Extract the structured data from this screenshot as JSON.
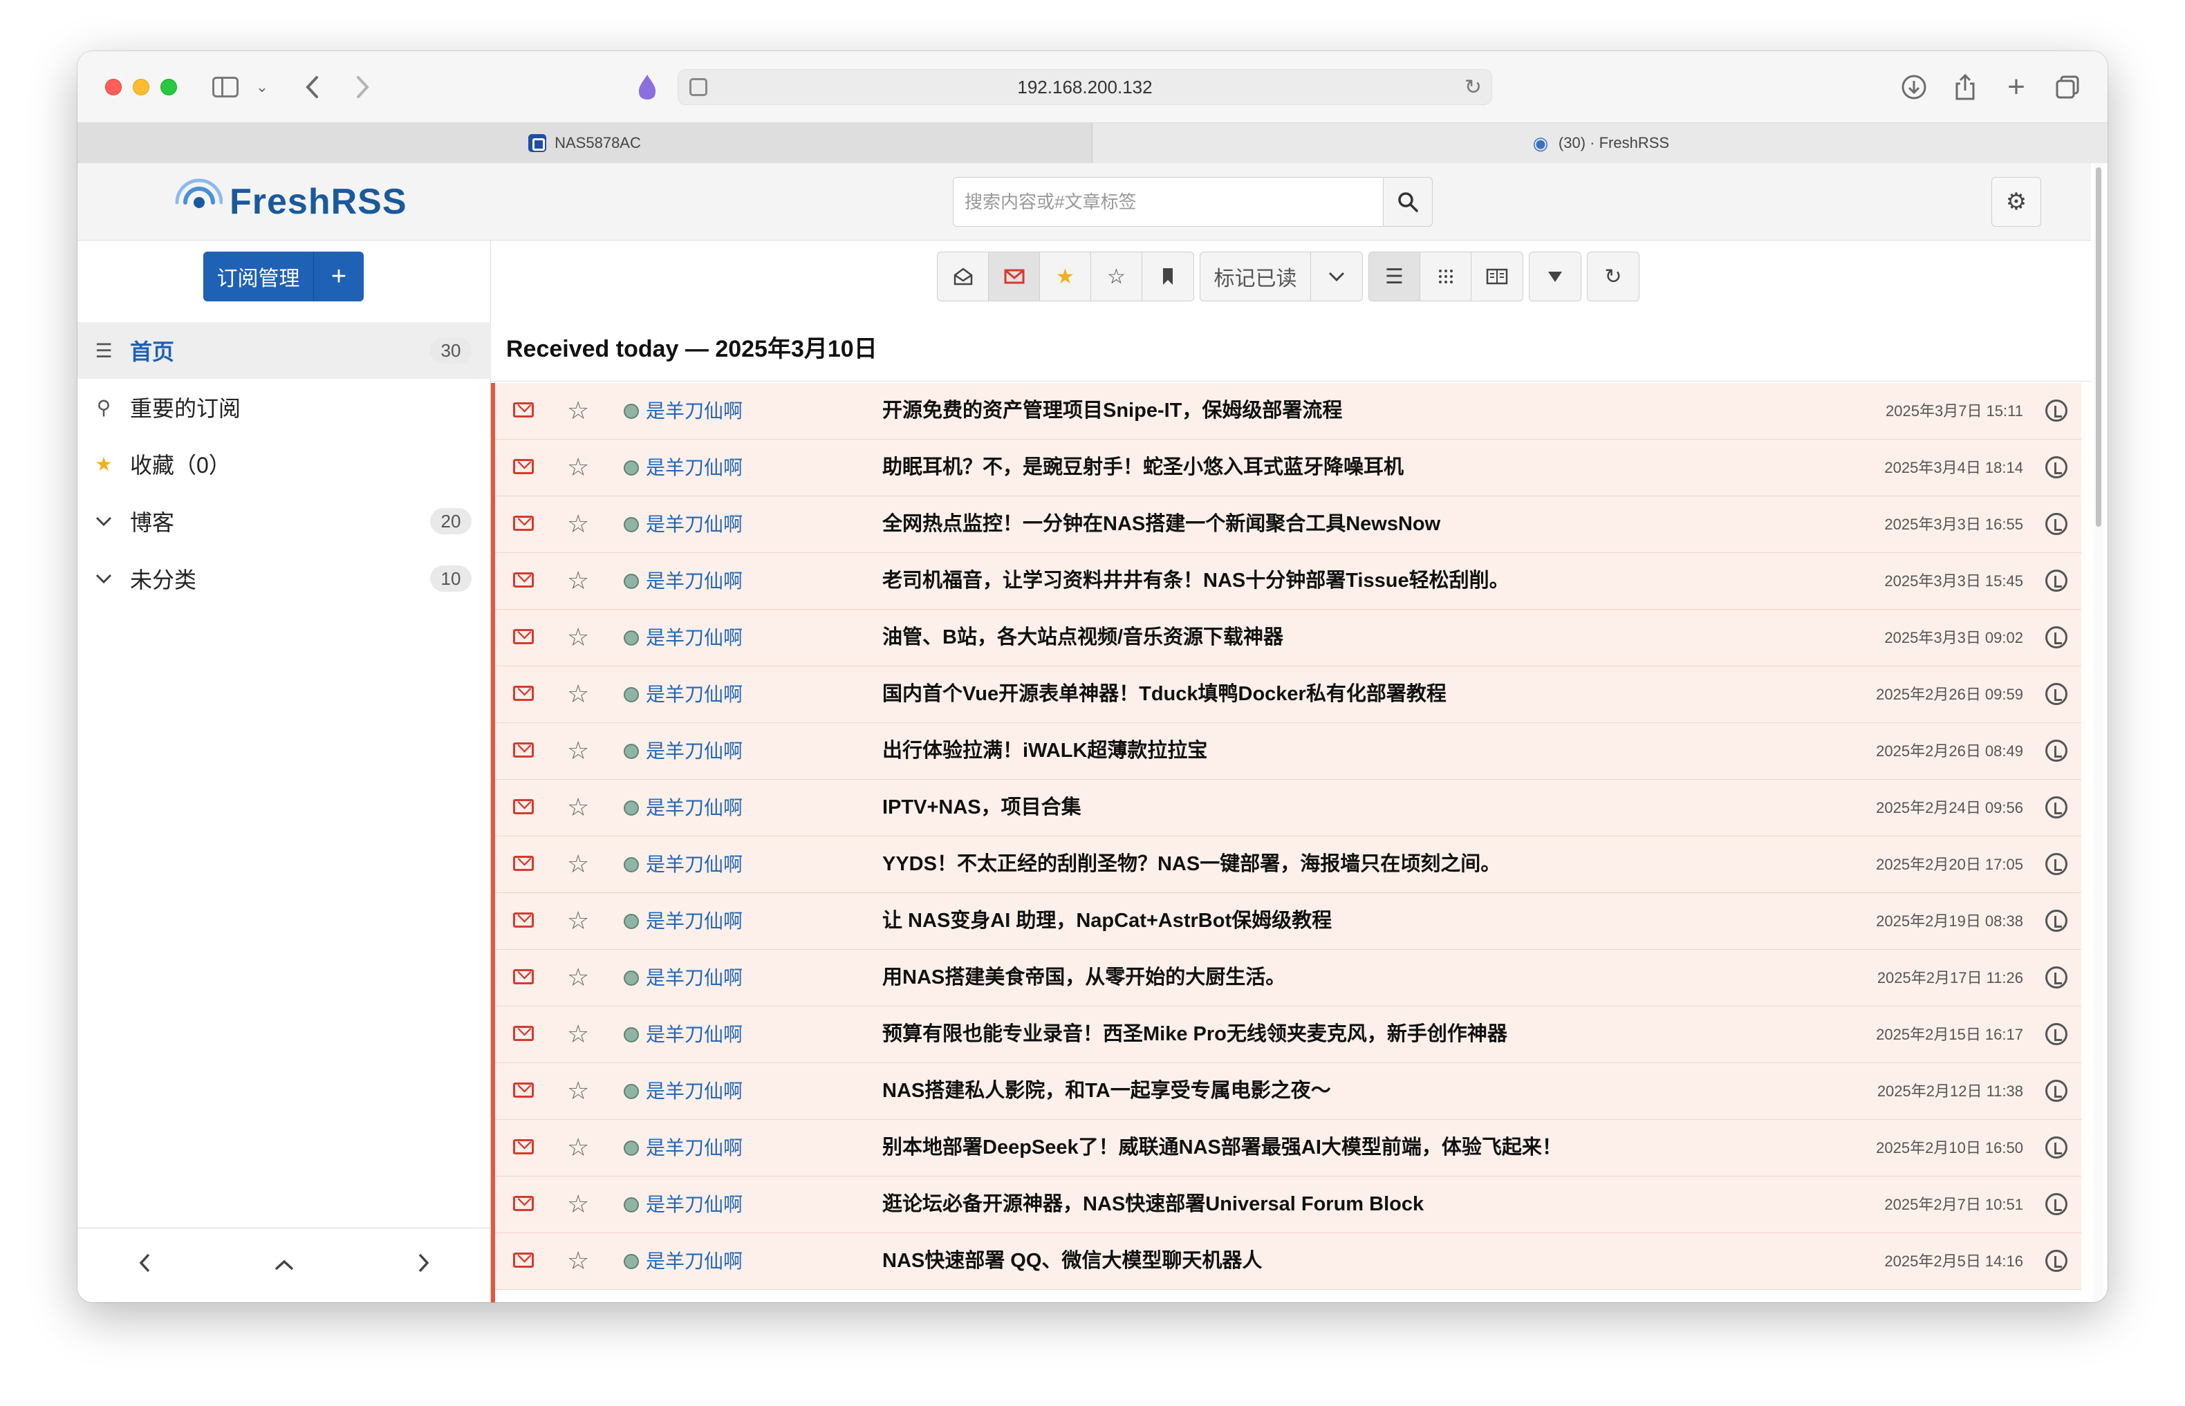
{
  "browser": {
    "address": "192.168.200.132",
    "tabs": [
      {
        "title": "NAS5878AC"
      },
      {
        "title": "(30) · FreshRSS"
      }
    ]
  },
  "app": {
    "logo_text": "FreshRSS",
    "search_placeholder": "搜索内容或#文章标签",
    "subscribe_label": "订阅管理",
    "add_label": "+",
    "toolbar": {
      "mark_read_label": "标记已读"
    },
    "sidebar": {
      "items": [
        {
          "label": "首页",
          "count": "30"
        },
        {
          "label": "重要的订阅",
          "count": ""
        },
        {
          "label": "收藏（0）",
          "count": ""
        },
        {
          "label": "博客",
          "count": "20"
        },
        {
          "label": "未分类",
          "count": "10"
        }
      ]
    },
    "day_title": "Received today — 2025年3月10日",
    "articles": [
      {
        "feed": "是羊刀仙啊",
        "title": "开源免费的资产管理项目Snipe-IT，保姆级部署流程",
        "date": "2025年3月7日 15:11"
      },
      {
        "feed": "是羊刀仙啊",
        "title": "助眠耳机？不，是豌豆射手！蛇圣小悠入耳式蓝牙降噪耳机",
        "date": "2025年3月4日 18:14"
      },
      {
        "feed": "是羊刀仙啊",
        "title": "全网热点监控！一分钟在NAS搭建一个新闻聚合工具NewsNow",
        "date": "2025年3月3日 16:55"
      },
      {
        "feed": "是羊刀仙啊",
        "title": "老司机福音，让学习资料井井有条！NAS十分钟部署Tissue轻松刮削。",
        "date": "2025年3月3日 15:45"
      },
      {
        "feed": "是羊刀仙啊",
        "title": "油管、B站，各大站点视频/音乐资源下载神器",
        "date": "2025年3月3日 09:02"
      },
      {
        "feed": "是羊刀仙啊",
        "title": "国内首个Vue开源表单神器！Tduck填鸭Docker私有化部署教程",
        "date": "2025年2月26日 09:59"
      },
      {
        "feed": "是羊刀仙啊",
        "title": "出行体验拉满！iWALK超薄款拉拉宝",
        "date": "2025年2月26日 08:49"
      },
      {
        "feed": "是羊刀仙啊",
        "title": "IPTV+NAS，项目合集",
        "date": "2025年2月24日 09:56"
      },
      {
        "feed": "是羊刀仙啊",
        "title": "YYDS！不太正经的刮削圣物？NAS一键部署，海报墙只在顷刻之间。",
        "date": "2025年2月20日 17:05"
      },
      {
        "feed": "是羊刀仙啊",
        "title": "让 NAS变身AI 助理，NapCat+AstrBot保姆级教程",
        "date": "2025年2月19日 08:38"
      },
      {
        "feed": "是羊刀仙啊",
        "title": "用NAS搭建美食帝国，从零开始的大厨生活。",
        "date": "2025年2月17日 11:26"
      },
      {
        "feed": "是羊刀仙啊",
        "title": "预算有限也能专业录音！西圣Mike Pro无线领夹麦克风，新手创作神器",
        "date": "2025年2月15日 16:17"
      },
      {
        "feed": "是羊刀仙啊",
        "title": "NAS搭建私人影院，和TA一起享受专属电影之夜～",
        "date": "2025年2月12日 11:38"
      },
      {
        "feed": "是羊刀仙啊",
        "title": "别本地部署DeepSeek了！威联通NAS部署最强AI大模型前端，体验飞起来！",
        "date": "2025年2月10日 16:50"
      },
      {
        "feed": "是羊刀仙啊",
        "title": "逛论坛必备开源神器，NAS快速部署Universal Forum Block",
        "date": "2025年2月7日 10:51"
      },
      {
        "feed": "是羊刀仙啊",
        "title": "NAS快速部署 QQ、微信大模型聊天机器人",
        "date": "2025年2月5日 14:16"
      }
    ]
  },
  "colors": {
    "accent": "#1f61b5",
    "unread_row": "#fdf0ea",
    "unread_marker": "#e2583d"
  }
}
